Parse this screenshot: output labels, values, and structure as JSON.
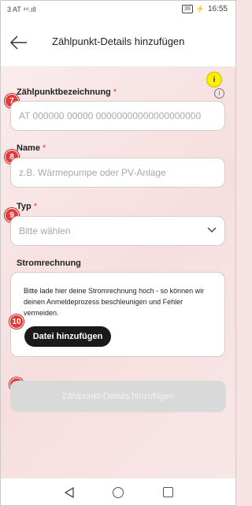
{
  "status_bar": {
    "left": "3 AT ⁴⁶.ıll",
    "battery": "39",
    "time": "16:55"
  },
  "header": {
    "title": "Zählpunkt-Details hinzufügen"
  },
  "badges": {
    "info": "i",
    "b7": "7",
    "b8": "8",
    "b9": "9",
    "b10": "10",
    "b11": "11"
  },
  "form": {
    "meter_label": "Zählpunktbezeichnung",
    "meter_required": "*",
    "meter_placeholder": "AT 000000 00000 00000000000000000000",
    "info_icon": "i",
    "name_label": "Name",
    "name_required": "*",
    "name_placeholder": "z.B. Wärmepumpe oder PV-Anlage",
    "type_label": "Typ",
    "type_required": "*",
    "type_placeholder": "Bitte wählen",
    "bill_label": "Stromrechnung",
    "bill_text": "Bitte lade hier deine Stromrechnung hoch - so können wir deinen Anmeldeprozess beschleunigen und Fehler vermeiden.",
    "upload_button": "Datei hinzufügen",
    "submit_button": "Zählpunkt-Details hinzufügen"
  },
  "icons": {
    "back": "arrow-left-icon",
    "chevron": "chevron-down-icon",
    "info": "info-icon"
  },
  "colors": {
    "accent_red": "#e53935",
    "badge_yellow": "#ffee00",
    "button_dark": "#1a1a1a",
    "button_disabled": "#d9d9d9"
  }
}
